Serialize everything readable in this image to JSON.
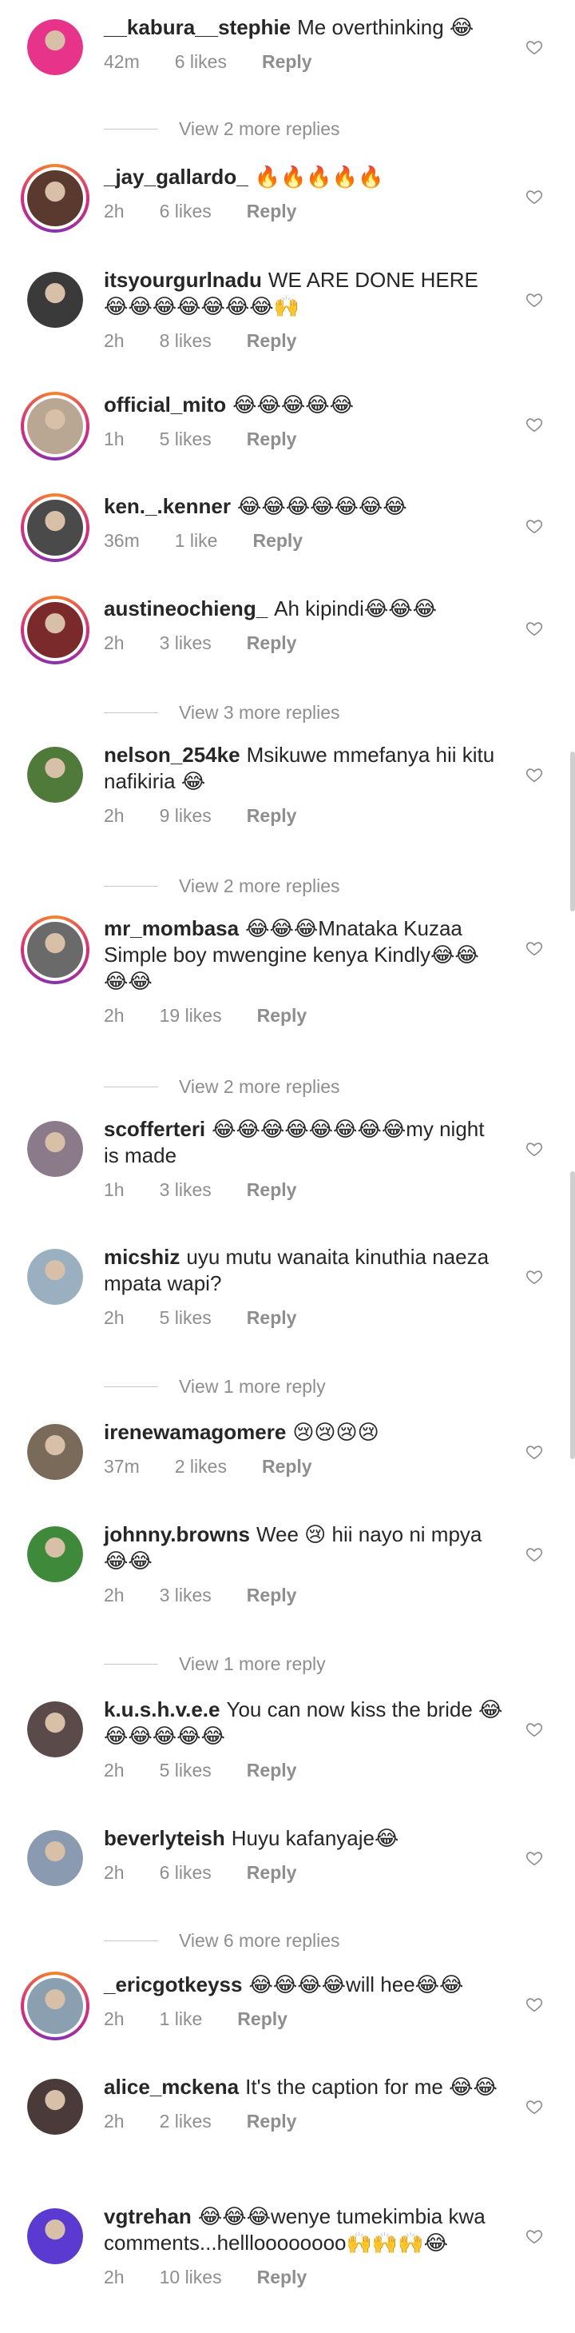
{
  "colors": {
    "accent_ring": "#dd2a7b",
    "meta_text": "#8e8e8e",
    "text": "#262626"
  },
  "comments": [
    {
      "username": "__kabura__stephie",
      "text": "Me overthinking 😂",
      "time": "42m",
      "likes": "6 likes",
      "reply": "Reply",
      "ring": false,
      "avatar_color": "#e8338a",
      "more_replies": "View 2 more replies"
    },
    {
      "username": "_jay_gallardo_",
      "text": "🔥🔥🔥🔥🔥",
      "time": "2h",
      "likes": "6 likes",
      "reply": "Reply",
      "ring": true,
      "avatar_color": "#5a3a2e",
      "more_replies": ""
    },
    {
      "username": "itsyourgurlnadu",
      "text": "WE ARE DONE HERE 😂😂😂😂😂😂😂🙌",
      "time": "2h",
      "likes": "8 likes",
      "reply": "Reply",
      "ring": false,
      "avatar_color": "#3a3a3a",
      "more_replies": ""
    },
    {
      "username": "official_mito",
      "text": "😂😂😂😂😂",
      "time": "1h",
      "likes": "5 likes",
      "reply": "Reply",
      "ring": true,
      "avatar_color": "#b9a793",
      "more_replies": ""
    },
    {
      "username": "ken._.kenner",
      "text": "😂😂😂😂😂😂😂",
      "time": "36m",
      "likes": "1 like",
      "reply": "Reply",
      "ring": true,
      "avatar_color": "#4a4a4a",
      "more_replies": ""
    },
    {
      "username": "austineochieng_",
      "text": "Ah kipindi😂😂😂",
      "time": "2h",
      "likes": "3 likes",
      "reply": "Reply",
      "ring": true,
      "avatar_color": "#7a2a2a",
      "more_replies": "View 3 more replies"
    },
    {
      "username": "nelson_254ke",
      "text": "Msikuwe mmefanya hii kitu nafikiria 😂",
      "time": "2h",
      "likes": "9 likes",
      "reply": "Reply",
      "ring": false,
      "avatar_color": "#4f7a3a",
      "more_replies": "View 2 more replies"
    },
    {
      "username": "mr_mombasa",
      "text": "😂😂😂Mnataka Kuzaa Simple boy mwengine kenya Kindly😂😂😂😂",
      "time": "2h",
      "likes": "19 likes",
      "reply": "Reply",
      "ring": true,
      "avatar_color": "#6a6a6a",
      "more_replies": "View 2 more replies"
    },
    {
      "username": "scofferteri",
      "text": "😂😂😂😂😂😂😂😂my night is made",
      "time": "1h",
      "likes": "3 likes",
      "reply": "Reply",
      "ring": false,
      "avatar_color": "#8a7a8a",
      "more_replies": ""
    },
    {
      "username": "micshiz",
      "text": "uyu mutu wanaita kinuthia naeza mpata wapi?",
      "time": "2h",
      "likes": "5 likes",
      "reply": "Reply",
      "ring": false,
      "avatar_color": "#9ab0c0",
      "more_replies": "View 1 more reply"
    },
    {
      "username": "irenewamagomere",
      "text": "😢😢😢😢",
      "time": "37m",
      "likes": "2 likes",
      "reply": "Reply",
      "ring": false,
      "avatar_color": "#7a6a5a",
      "more_replies": ""
    },
    {
      "username": "johnny.browns",
      "text": "Wee 😢 hii nayo ni mpya 😂😂",
      "time": "2h",
      "likes": "3 likes",
      "reply": "Reply",
      "ring": false,
      "avatar_color": "#3f8a3a",
      "more_replies": "View 1 more reply"
    },
    {
      "username": "k.u.s.h.v.e.e",
      "text": "You can now kiss the bride 😂😂😂😂😂😂",
      "time": "2h",
      "likes": "5 likes",
      "reply": "Reply",
      "ring": false,
      "avatar_color": "#5a4a4a",
      "more_replies": ""
    },
    {
      "username": "beverlyteish",
      "text": "Huyu kafanyaje😂",
      "time": "2h",
      "likes": "6 likes",
      "reply": "Reply",
      "ring": false,
      "avatar_color": "#8a9ab0",
      "more_replies": "View 6 more replies"
    },
    {
      "username": "_ericgotkeyss",
      "text": "😂😂😂😂will hee😂😂",
      "time": "2h",
      "likes": "1 like",
      "reply": "Reply",
      "ring": true,
      "avatar_color": "#8aa0b0",
      "more_replies": ""
    },
    {
      "username": "alice_mckena",
      "text": "It's the caption for me 😂😂",
      "time": "2h",
      "likes": "2 likes",
      "reply": "Reply",
      "ring": false,
      "avatar_color": "#4a3a3a",
      "more_replies": ""
    },
    {
      "username": "vgtrehan",
      "text": "😂😂😂wenye tumekimbia kwa comments...hellloooooooo🙌🙌🙌😂",
      "time": "2h",
      "likes": "10 likes",
      "reply": "Reply",
      "ring": false,
      "avatar_color": "#5a3ad0",
      "more_replies": ""
    }
  ]
}
